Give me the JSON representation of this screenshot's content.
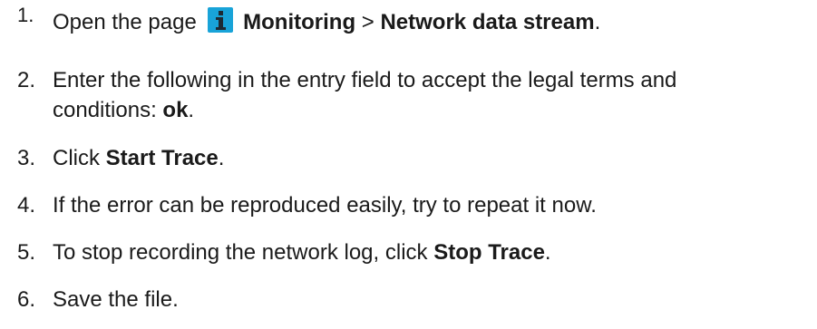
{
  "steps": [
    {
      "number": "1.",
      "text_before": "Open the page ",
      "bold1": "Monitoring",
      "sep": " > ",
      "bold2": "Network data stream",
      "after": "."
    },
    {
      "number": "2.",
      "line1": "Enter the following in the entry field to accept the legal terms and",
      "line2_before": "conditions: ",
      "bold": "ok",
      "after": "."
    },
    {
      "number": "3.",
      "before": "Click ",
      "bold": "Start Trace",
      "after": "."
    },
    {
      "number": "4.",
      "text": "If the error can be reproduced easily, try to repeat it now."
    },
    {
      "number": "5.",
      "before": "To stop recording the network log, click ",
      "bold": "Stop Trace",
      "after": "."
    },
    {
      "number": "6.",
      "text": "Save the file."
    }
  ],
  "icons": {
    "info": "info-icon",
    "info_color": "#18a3d8"
  }
}
